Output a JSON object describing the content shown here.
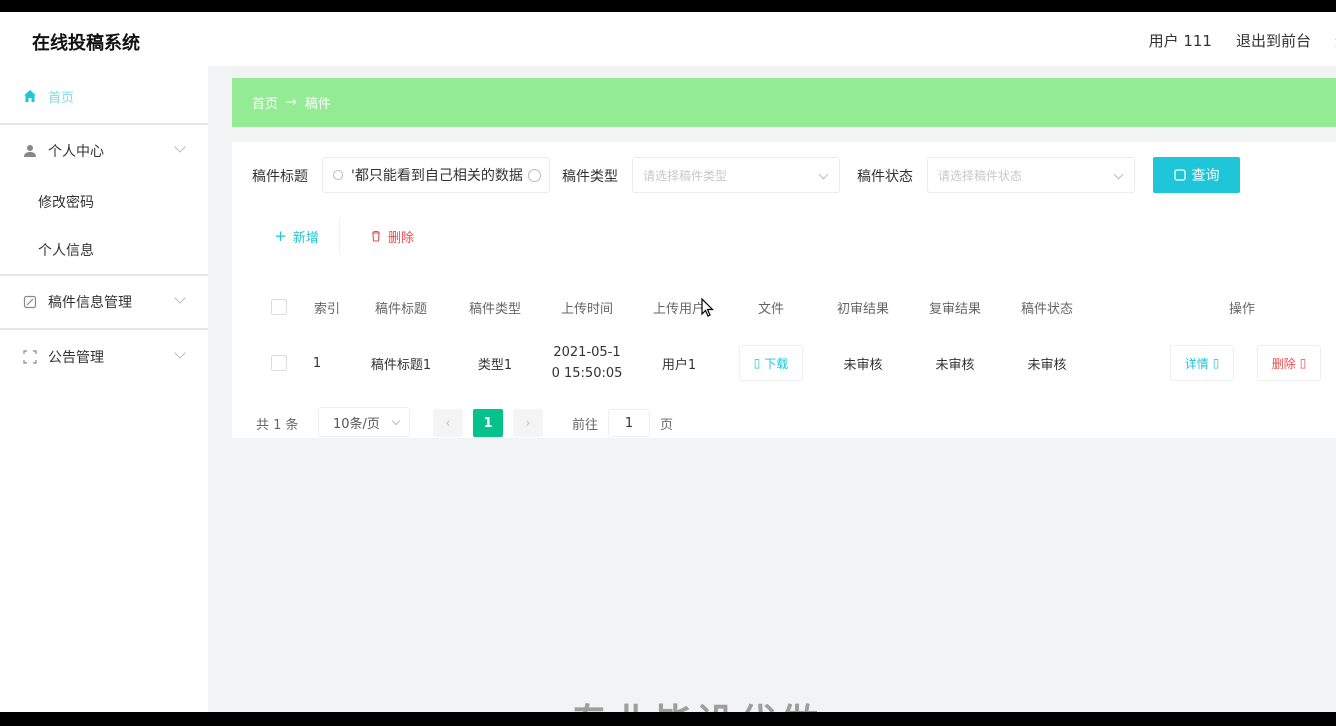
{
  "header": {
    "brand": "在线投稿系统",
    "user": "用户 111",
    "back_to_front": "退出到前台",
    "logout": "退"
  },
  "sidebar": {
    "home": "首页",
    "personal_center": "个人中心",
    "change_password": "修改密码",
    "personal_info": "个人信息",
    "manuscript_mgmt": "稿件信息管理",
    "notice_mgmt": "公告管理"
  },
  "breadcrumb": {
    "root": "首页",
    "arrow": "→",
    "current": "稿件"
  },
  "search": {
    "title_label": "稿件标题",
    "title_value": "'都只能看到自己相关的数据",
    "type_label": "稿件类型",
    "type_placeholder": "请选择稿件类型",
    "status_label": "稿件状态",
    "status_placeholder": "请选择稿件状态",
    "query_button": "查询"
  },
  "actions": {
    "add": "新增",
    "delete": "删除"
  },
  "table": {
    "headers": [
      "索引",
      "稿件标题",
      "稿件类型",
      "上传时间",
      "上传用户",
      "文件",
      "初审结果",
      "复审结果",
      "稿件状态",
      "操作"
    ],
    "rows": [
      {
        "index": "1",
        "title": "稿件标题1",
        "type": "类型1",
        "upload_time_line1": "2021-05-1",
        "upload_time_line2": "0 15:50:05",
        "user": "用户1",
        "file_button": "下载",
        "first_review": "未审核",
        "second_review": "未审核",
        "status": "未审核",
        "detail_button": "详情",
        "delete_button": "删除"
      }
    ]
  },
  "pagination": {
    "total": "共 1 条",
    "page_size": "10条/页",
    "current_page": "1",
    "goto_label": "前往",
    "goto_value": "1",
    "page_unit": "页"
  },
  "watermark": "专业毕设代做",
  "colors": {
    "accent": "#1fc5d8",
    "breadcrumb_bg": "#93ec93",
    "danger": "#ee4c4c",
    "active_page": "#05c18c"
  }
}
